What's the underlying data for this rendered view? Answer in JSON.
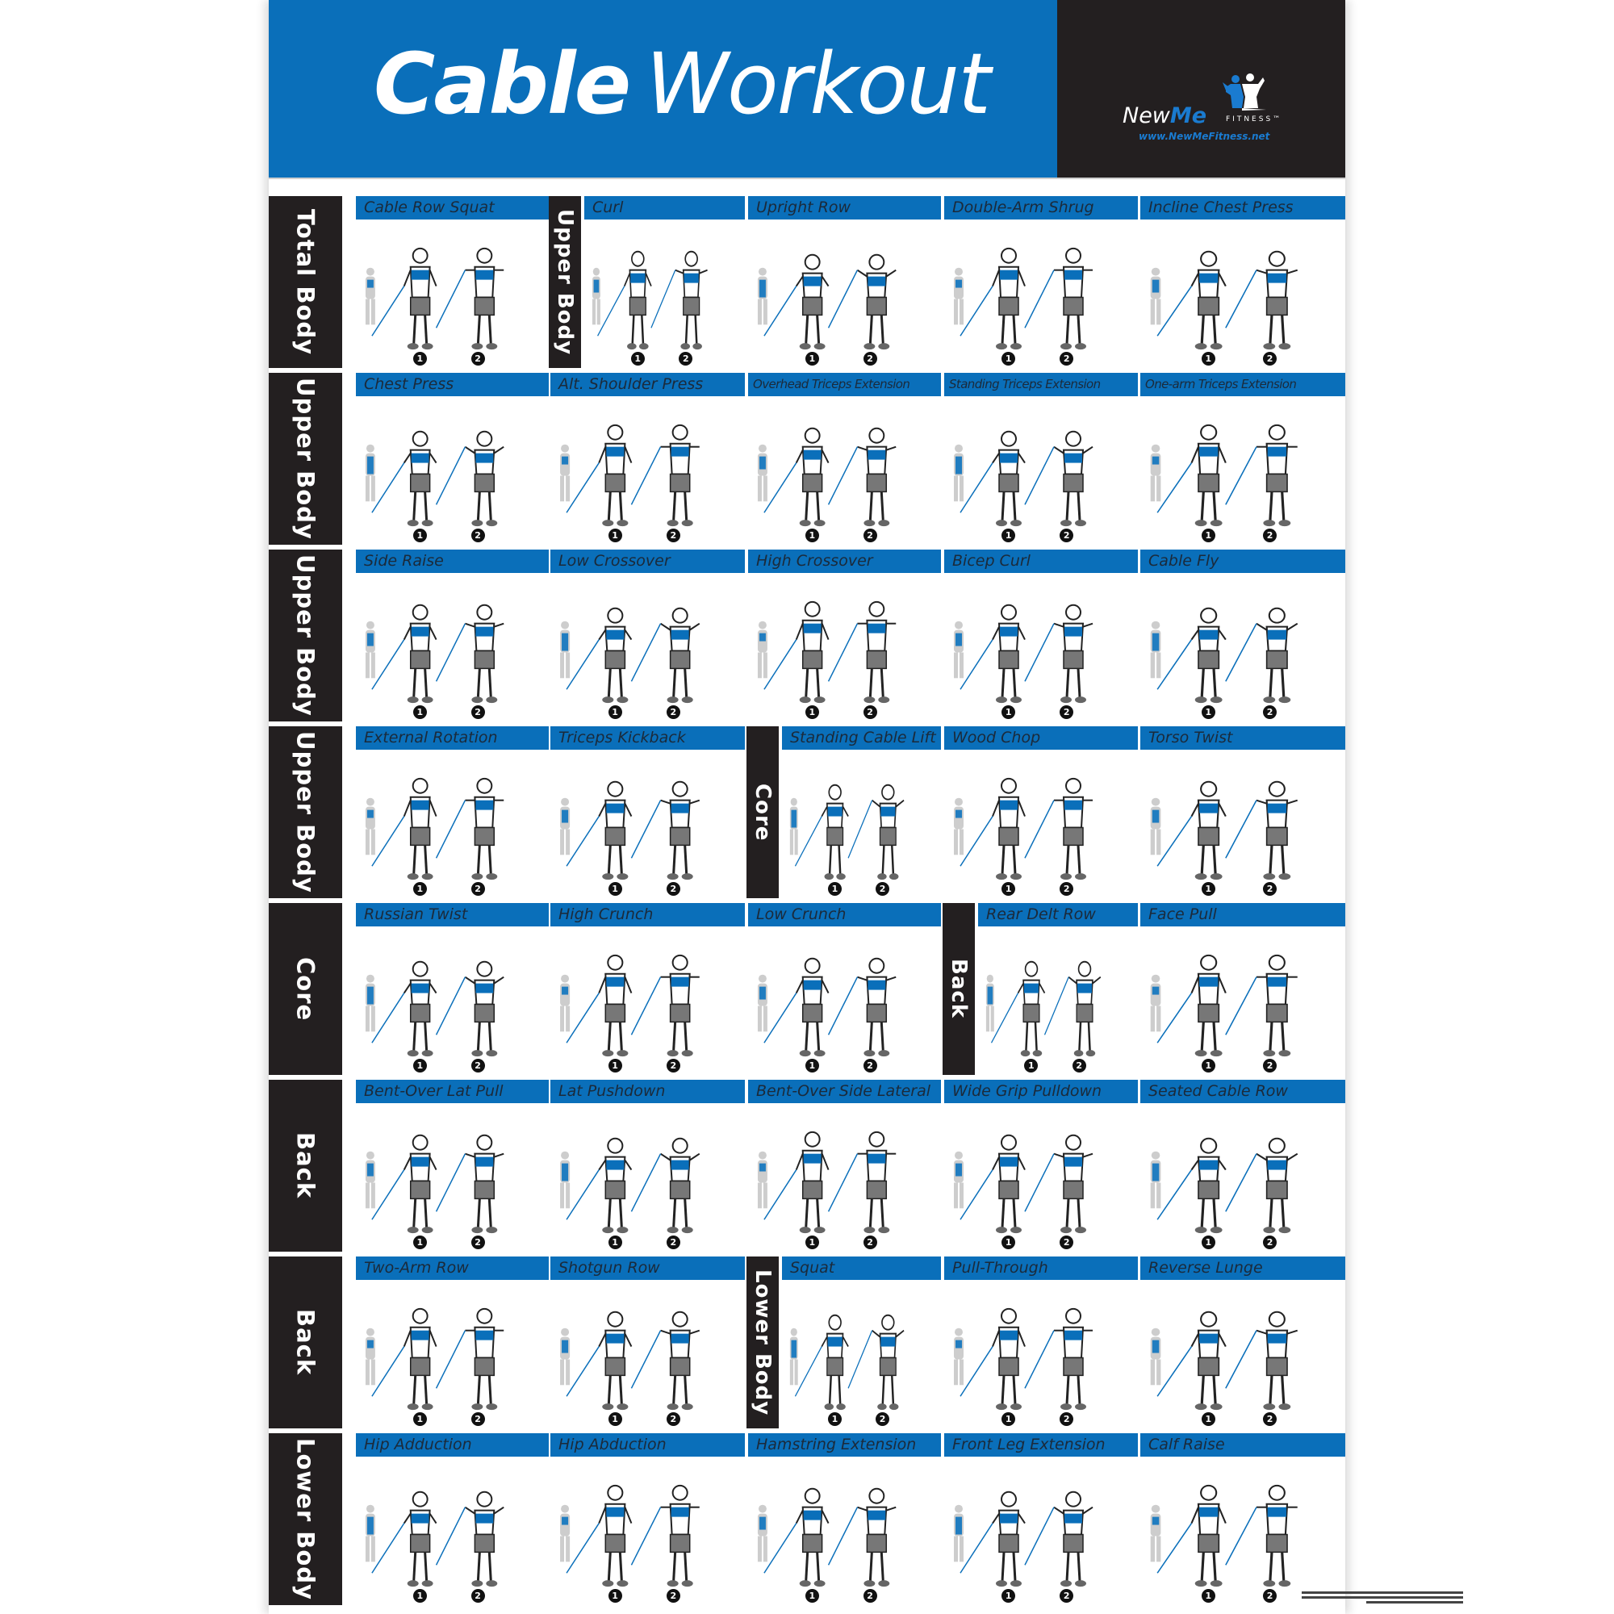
{
  "poster": {
    "title_bold": "Cable",
    "title_light": "Workout",
    "brand": {
      "name_part1": "New",
      "name_part2": "Me",
      "name_suffix": "FITNESS™",
      "url": "www.NewMeFitness.net",
      "icon": "flexing-couple-logo-icon"
    },
    "colors": {
      "accent_blue": "#0a6fba",
      "dark": "#231f20",
      "label_text": "#1b2a3a"
    },
    "step_labels": [
      "1",
      "2"
    ],
    "fine_print_present": true
  },
  "rows": [
    {
      "category": "Total Body",
      "cards": [
        {
          "name": "Cable Row Squat"
        },
        {
          "name": "Curl",
          "inline_category": "Upper Body"
        },
        {
          "name": "Upright Row"
        },
        {
          "name": "Double-Arm Shrug"
        },
        {
          "name": "Incline Chest Press"
        }
      ]
    },
    {
      "category": "Upper Body",
      "cards": [
        {
          "name": "Chest Press"
        },
        {
          "name": "Alt. Shoulder Press"
        },
        {
          "name": "Overhead Triceps Extension"
        },
        {
          "name": "Standing Triceps Extension"
        },
        {
          "name": "One-arm Triceps Extension"
        }
      ]
    },
    {
      "category": "Upper Body",
      "cards": [
        {
          "name": "Side Raise"
        },
        {
          "name": "Low Crossover"
        },
        {
          "name": "High Crossover"
        },
        {
          "name": "Bicep Curl"
        },
        {
          "name": "Cable Fly"
        }
      ]
    },
    {
      "category": "Upper Body",
      "cards": [
        {
          "name": "External Rotation"
        },
        {
          "name": "Triceps Kickback"
        },
        {
          "name": "Standing Cable Lift",
          "inline_category": "Core"
        },
        {
          "name": "Wood Chop"
        },
        {
          "name": "Torso Twist"
        }
      ]
    },
    {
      "category": "Core",
      "cards": [
        {
          "name": "Russian Twist"
        },
        {
          "name": "High Crunch"
        },
        {
          "name": "Low Crunch"
        },
        {
          "name": "Rear Delt Row",
          "inline_category": "Back"
        },
        {
          "name": "Face Pull"
        }
      ]
    },
    {
      "category": "Back",
      "cards": [
        {
          "name": "Bent-Over Lat Pull"
        },
        {
          "name": "Lat Pushdown"
        },
        {
          "name": "Bent-Over Side Lateral"
        },
        {
          "name": "Wide Grip Pulldown"
        },
        {
          "name": "Seated Cable Row"
        }
      ]
    },
    {
      "category": "Back",
      "cards": [
        {
          "name": "Two-Arm Row"
        },
        {
          "name": "Shotgun Row"
        },
        {
          "name": "Squat",
          "inline_category": "Lower Body"
        },
        {
          "name": "Pull-Through"
        },
        {
          "name": "Reverse Lunge"
        }
      ]
    },
    {
      "category": "Lower Body",
      "cards": [
        {
          "name": "Hip Adduction"
        },
        {
          "name": "Hip Abduction"
        },
        {
          "name": "Hamstring Extension"
        },
        {
          "name": "Front Leg Extension"
        },
        {
          "name": "Calf Raise"
        }
      ]
    }
  ]
}
